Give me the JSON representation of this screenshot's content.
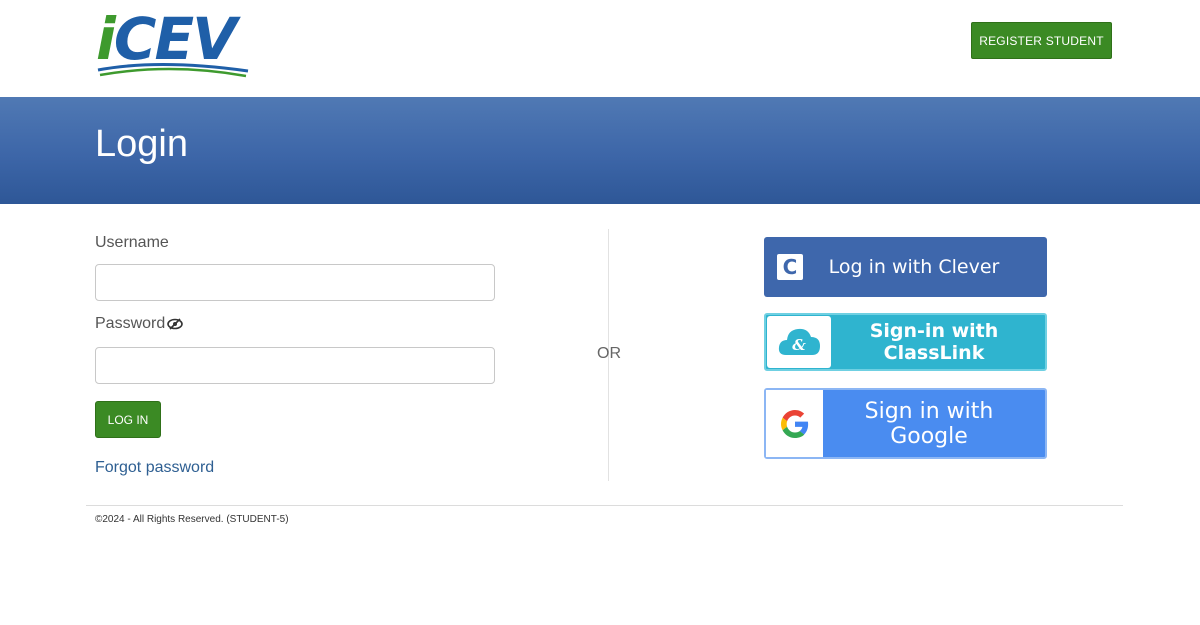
{
  "header": {
    "logo": {
      "text_i": "i",
      "text_cev": "CEV"
    },
    "register_label": "REGISTER STUDENT"
  },
  "banner": {
    "title": "Login"
  },
  "form": {
    "username_label": "Username",
    "username_value": "",
    "password_label": "Password",
    "password_value": "",
    "login_label": "LOG IN",
    "forgot_label": "Forgot password"
  },
  "separator": {
    "or_label": "OR"
  },
  "sso": {
    "clever": {
      "label": "Log in with Clever",
      "icon": "clever-icon",
      "color": "#3e67ac"
    },
    "classlink": {
      "label": "Sign-in with ClassLink",
      "icon": "classlink-icon",
      "color": "#2fb4cf"
    },
    "google": {
      "label": "Sign in with Google",
      "icon": "google-icon",
      "color": "#4a8cf0"
    }
  },
  "footer": {
    "text": "©2024 - All Rights Reserved. (STUDENT-5)"
  },
  "colors": {
    "green": "#3b8a24",
    "blue_banner": "#3d66a8"
  }
}
